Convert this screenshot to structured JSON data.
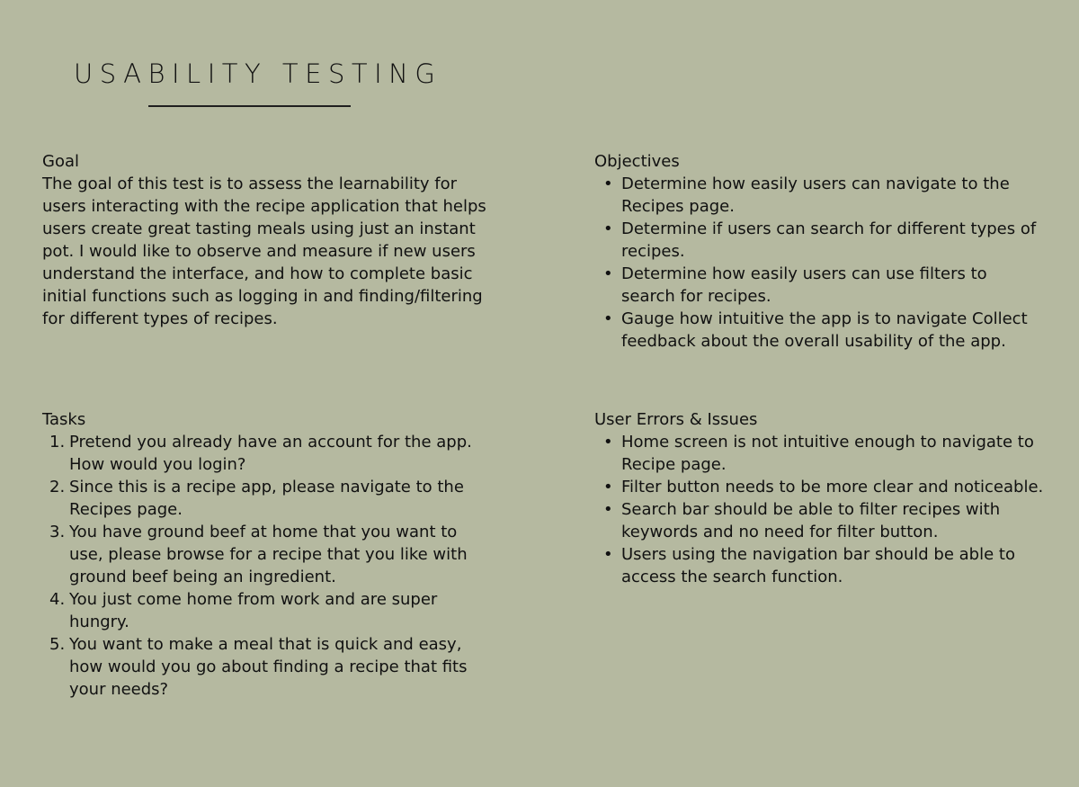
{
  "title": "USABILITY TESTING",
  "goal": {
    "heading": "Goal",
    "text": "The goal of this test is to assess the learnability for users interacting with the recipe application that helps users create great tasting meals using just an instant pot. I would like to observe and measure if new users understand the interface, and how to complete basic initial functions such as logging in and finding/filtering for different types of recipes."
  },
  "objectives": {
    "heading": "Objectives",
    "items": [
      "Determine how easily users can navigate to the Recipes page.",
      "Determine if users can search for different types of recipes.",
      "Determine how easily users can use filters to search for recipes.",
      "Gauge how intuitive the app is to navigate Collect feedback about the overall usability of the app."
    ]
  },
  "tasks": {
    "heading": "Tasks",
    "items": [
      {
        "num": "1.",
        "text": "Pretend you already have an account for the app. How would you login?"
      },
      {
        "num": "2.",
        "text": "Since this is a recipe app, please navigate to the Recipes page."
      },
      {
        "num": "3.",
        "text": "You have ground beef at home that you want to use, please browse for a recipe that you like with ground beef being an ingredient."
      },
      {
        "num": "4.",
        "text": "You just come home from work and are super hungry."
      },
      {
        "num": "5.",
        "text": "You want to make a meal that is quick and easy, how would you go about finding a recipe that fits your needs?"
      }
    ]
  },
  "errors": {
    "heading": "User Errors & Issues",
    "items": [
      "Home screen is not intuitive enough to navigate to Recipe page.",
      "Filter button needs to be more clear and noticeable.",
      "Search bar should be able to filter recipes with keywords and no need for filter button.",
      "Users using the navigation bar should be able to access the search function."
    ]
  },
  "bullet_glyph": "•"
}
